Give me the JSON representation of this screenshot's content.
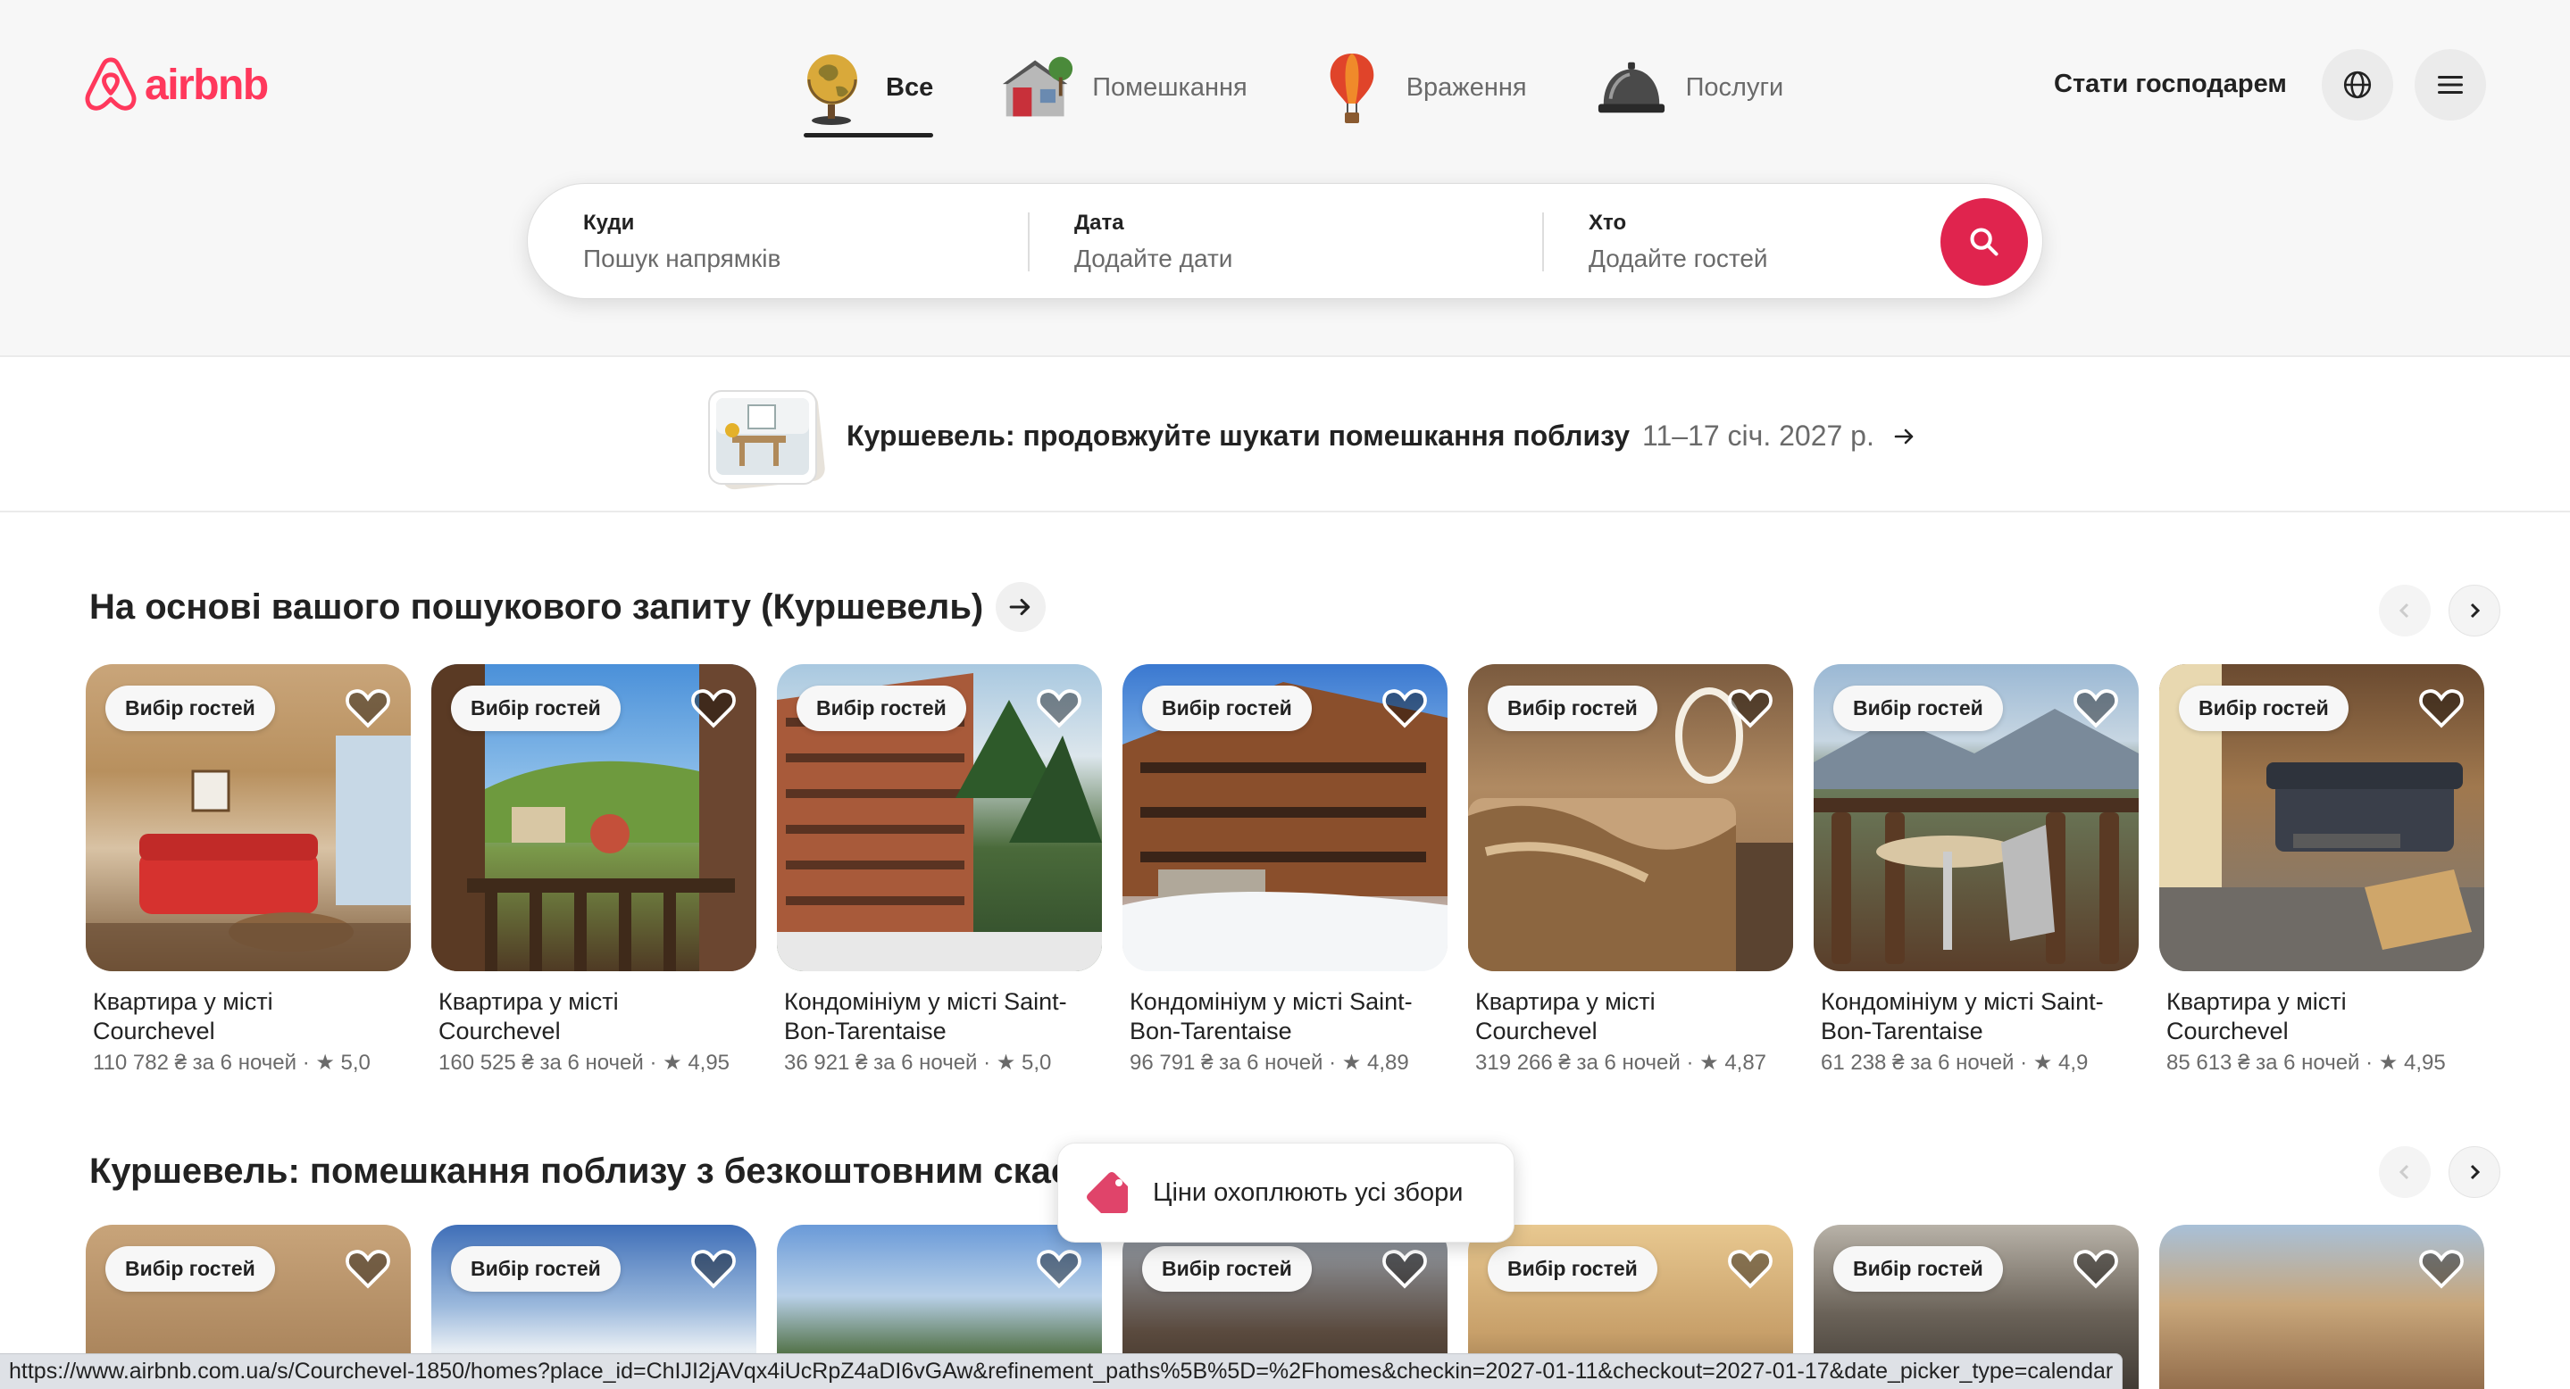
{
  "brand": {
    "name": "airbnb",
    "color": "#ff385c"
  },
  "nav": [
    {
      "label": "Все",
      "icon": "globe-icon",
      "active": true
    },
    {
      "label": "Помешкання",
      "icon": "house-icon",
      "active": false
    },
    {
      "label": "Враження",
      "icon": "hot-air-balloon-icon",
      "active": false
    },
    {
      "label": "Послуги",
      "icon": "service-bell-icon",
      "active": false
    }
  ],
  "header": {
    "host_link": "Стати господарем",
    "globe_icon": "language-globe-icon",
    "menu_icon": "hamburger-menu-icon"
  },
  "search": {
    "where_label": "Куди",
    "where_placeholder": "Пошук напрямків",
    "date_label": "Дата",
    "date_placeholder": "Додайте дати",
    "who_label": "Хто",
    "who_placeholder": "Додайте гостей",
    "button_icon": "search-icon",
    "button_color": "#e0244e"
  },
  "recent": {
    "text": "Куршевель: продовжуйте шукати помешкання поблизу",
    "dates": "11–17 січ. 2027 р."
  },
  "section1": {
    "title": "На основі вашого пошукового запиту (Куршевель)",
    "cards": [
      {
        "badge": "Вибір гостей",
        "title_line1": "Квартира у місті",
        "title_line2": "Courchevel",
        "meta": "110 782 ₴ за 6 ночей · ★ 5,0"
      },
      {
        "badge": "Вибір гостей",
        "title_line1": "Квартира у місті",
        "title_line2": "Courchevel",
        "meta": "160 525 ₴ за 6 ночей · ★ 4,95"
      },
      {
        "badge": "Вибір гостей",
        "title_line1": "Кондомініум у місті Saint-",
        "title_line2": "Bon-Tarentaise",
        "meta": "36 921 ₴ за 6 ночей · ★ 5,0"
      },
      {
        "badge": "Вибір гостей",
        "title_line1": "Кондомініум у місті Saint-",
        "title_line2": "Bon-Tarentaise",
        "meta": "96 791 ₴ за 6 ночей · ★ 4,89"
      },
      {
        "badge": "Вибір гостей",
        "title_line1": "Квартира у місті",
        "title_line2": "Courchevel",
        "meta": "319 266 ₴ за 6 ночей · ★ 4,87"
      },
      {
        "badge": "Вибір гостей",
        "title_line1": "Кондомініум у місті Saint-",
        "title_line2": "Bon-Tarentaise",
        "meta": "61 238 ₴ за 6 ночей · ★ 4,9"
      },
      {
        "badge": "Вибір гостей",
        "title_line1": "Квартира у місті",
        "title_line2": "Courchevel",
        "meta": "85 613 ₴ за 6 ночей · ★ 4,95"
      }
    ]
  },
  "section2": {
    "title": "Куршевель: помешкання поблизу з безкоштовним скас",
    "badges": [
      "Вибір гостей",
      "Вибір гостей",
      "",
      "Вибір гостей",
      "Вибір гостей",
      "Вибір гостей",
      ""
    ]
  },
  "tooltip": {
    "text": "Ціни охоплюють усі збори",
    "icon": "price-tag-icon"
  },
  "statusbar": {
    "url": "https://www.airbnb.com.ua/s/Courchevel-1850/homes?place_id=ChIJI2jAVqx4iUcRpZ4aDI6vGAw&refinement_paths%5B%5D=%2Fhomes&checkin=2027-01-11&checkout=2027-01-17&date_picker_type=calendar"
  }
}
